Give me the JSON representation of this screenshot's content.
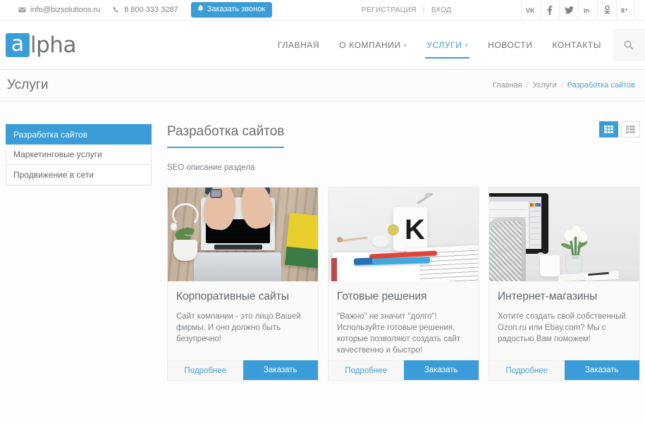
{
  "topbar": {
    "email": "info@bizsolutions.ru",
    "phone": "8 800 333 3287",
    "callback_label": "Заказать звонок",
    "register_label": "РЕГИСТРАЦИЯ",
    "login_label": "ВХОД",
    "separator": "|",
    "social": [
      {
        "name": "vk-icon",
        "glyph": "vk"
      },
      {
        "name": "facebook-icon",
        "glyph": "f"
      },
      {
        "name": "twitter-icon",
        "glyph": "✈"
      },
      {
        "name": "linkedin-icon",
        "glyph": "in"
      },
      {
        "name": "odnoklassniki-icon",
        "glyph": "§"
      },
      {
        "name": "google-plus-icon",
        "glyph": "g+"
      }
    ]
  },
  "header": {
    "logo_mark": "a",
    "logo_text": "lpha",
    "nav": [
      {
        "label": "ГЛАВНАЯ",
        "active": false,
        "has_caret": false
      },
      {
        "label": "О КОМПАНИИ",
        "active": false,
        "has_caret": true
      },
      {
        "label": "УСЛУГИ",
        "active": true,
        "has_caret": true
      },
      {
        "label": "НОВОСТИ",
        "active": false,
        "has_caret": false
      },
      {
        "label": "КОНТАКТЫ",
        "active": false,
        "has_caret": false
      }
    ],
    "search_icon": "search-icon"
  },
  "page": {
    "title": "Услуги",
    "breadcrumbs": [
      {
        "label": "Главная",
        "current": false
      },
      {
        "label": "Услуги",
        "current": false
      },
      {
        "label": "Разработка сайтов",
        "current": true
      }
    ],
    "breadcrumb_separator": "/"
  },
  "sidebar": {
    "items": [
      {
        "label": "Разработка сайтов",
        "active": true
      },
      {
        "label": "Маркетинговые услуги",
        "active": false
      },
      {
        "label": "Продвижение в сети",
        "active": false
      }
    ]
  },
  "content": {
    "section_title": "Разработка сайтов",
    "seo_text": "SEO описание раздела",
    "view_modes": [
      {
        "name": "grid-view-button",
        "active": true
      },
      {
        "name": "list-view-button",
        "active": false
      }
    ],
    "cards": [
      {
        "title": "Корпоративные сайты",
        "desc": "Сайт компании - это лицо Вашей фирмы. И оно должно быть безупречно!",
        "more_label": "Подробнее",
        "order_label": "Заказать",
        "image": "laptop-hands-desk-photo"
      },
      {
        "title": "Готовые решения",
        "desc": "\"Важно\" не значит \"долго\"! Используйте готовые решения, которые позволяют создать сайт качественно и быстро!",
        "more_label": "Подробнее",
        "order_label": "Заказать",
        "image": "mug-pens-notebook-photo"
      },
      {
        "title": "Интернет-магазины",
        "desc": "Хотите создать свой собственный Ozon.ru или Ebay.com? Мы с радостью Вам поможем!",
        "more_label": "Подробнее",
        "order_label": "Заказать",
        "image": "imac-tulips-desk-photo"
      }
    ]
  },
  "colors": {
    "accent": "#3b9dd8",
    "link": "#4a9fdb",
    "text": "#6e7479",
    "muted": "#8d9399",
    "border": "#e6e6e6"
  }
}
